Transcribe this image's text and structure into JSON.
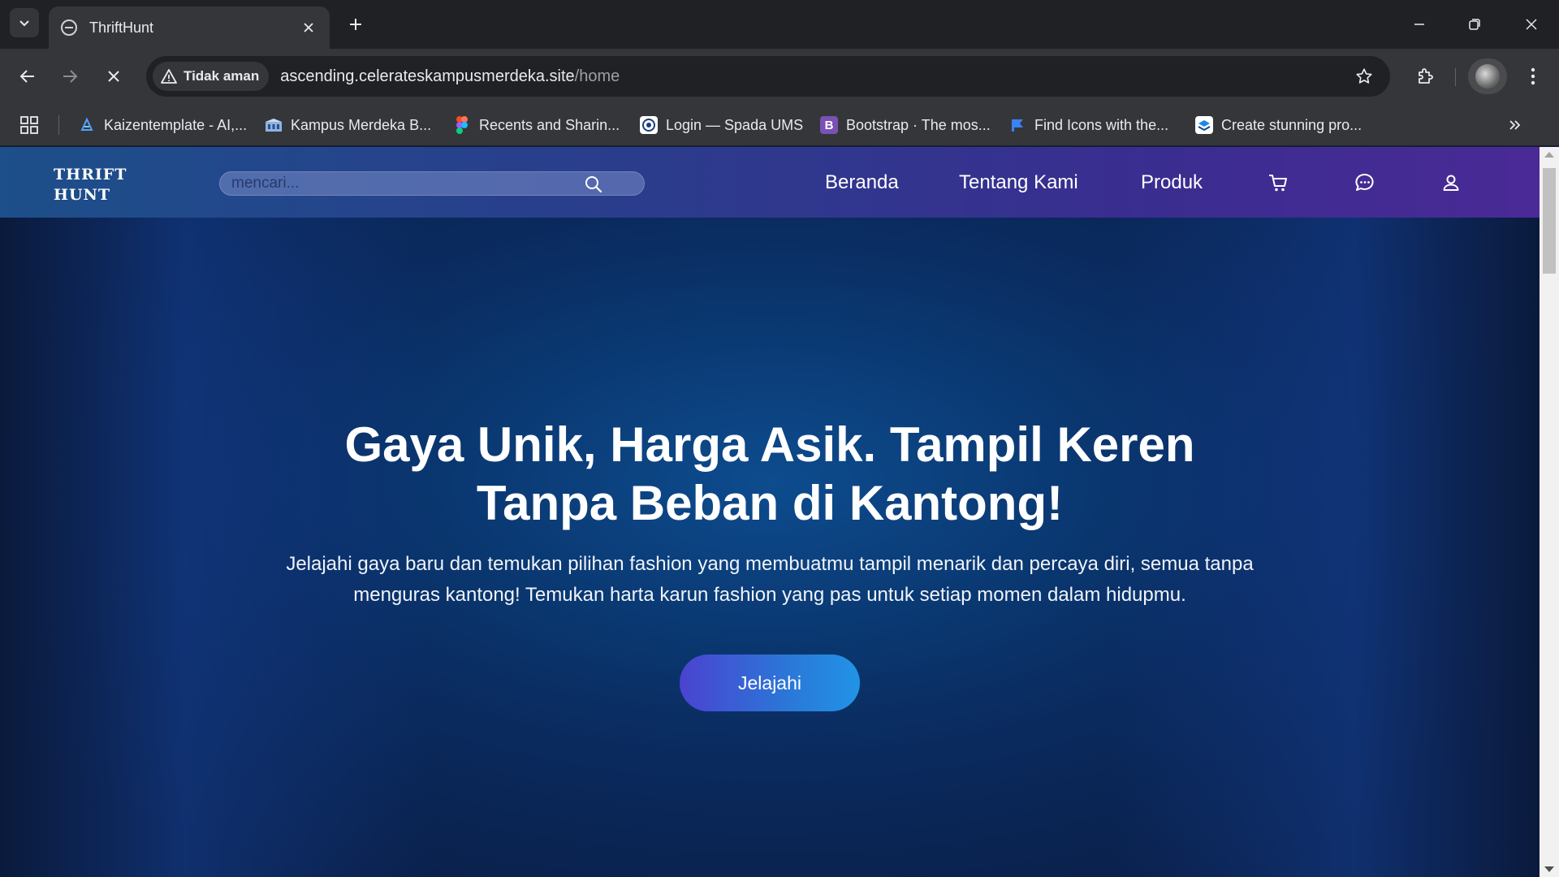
{
  "browser": {
    "tab": {
      "title": "ThriftHunt",
      "favicon": "thrifthunt-favicon"
    },
    "address_bar": {
      "security_label": "Tidak aman",
      "url_host": "ascending.celerateskampusmerdeka.site",
      "url_path": "/home"
    },
    "bookmarks": [
      {
        "label": "Kaizentemplate - AI,...",
        "icon": "kaizen-icon"
      },
      {
        "label": "Kampus Merdeka B...",
        "icon": "kampus-merdeka-icon"
      },
      {
        "label": "Recents and Sharin...",
        "icon": "figma-icon"
      },
      {
        "label": "Login — Spada UMS",
        "icon": "spada-icon"
      },
      {
        "label": "Bootstrap · The mos...",
        "icon": "bootstrap-icon",
        "glyph": "B"
      },
      {
        "label": "Find Icons with the...",
        "icon": "flag-icon"
      },
      {
        "label": "Create stunning pro...",
        "icon": "layers-icon"
      }
    ]
  },
  "site": {
    "logo": {
      "line1": "THRIFT",
      "line2": "HUNT"
    },
    "search": {
      "placeholder": "mencari..."
    },
    "nav": {
      "home": "Beranda",
      "about": "Tentang Kami",
      "products": "Produk"
    },
    "hero": {
      "title": "Gaya Unik, Harga Asik. Tampil Keren Tanpa Beban di Kantong!",
      "description": "Jelajahi gaya baru dan temukan pilihan fashion yang membuatmu tampil menarik dan percaya diri, semua tanpa menguras kantong! Temukan harta karun fashion yang pas untuk setiap momen dalam hidupmu.",
      "cta_label": "Jelajahi"
    }
  },
  "colors": {
    "chrome_dark": "#202124",
    "chrome_mid": "#35363a",
    "nav_gradient_start": "#1d4f8a",
    "nav_gradient_end": "#4a2a96",
    "hero_center": "#0d4c8e",
    "cta_start": "#4a43d0",
    "cta_end": "#2194e6"
  }
}
